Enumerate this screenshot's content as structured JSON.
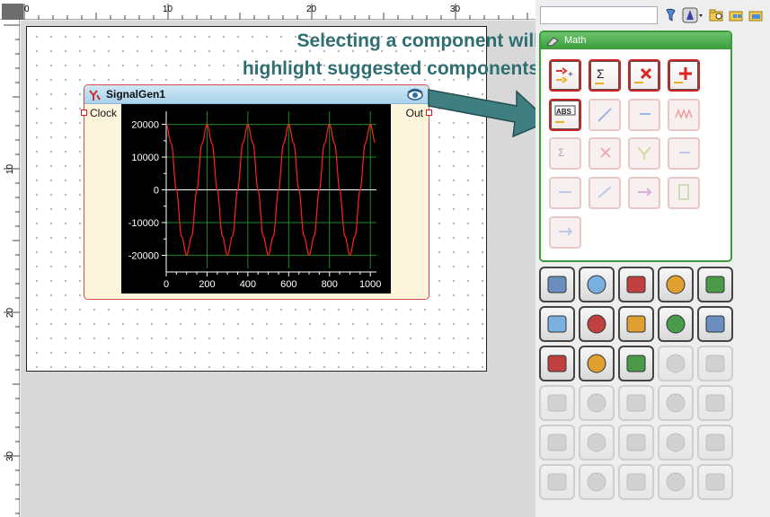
{
  "ruler": {
    "top_ticks": [
      "0",
      "10",
      "20",
      "30"
    ],
    "left_ticks": [
      "10",
      "20",
      "30"
    ]
  },
  "component": {
    "title": "SignalGen1",
    "input_port": "Clock",
    "output_port": "Out"
  },
  "chart_data": {
    "type": "line",
    "x": [
      0,
      25,
      50,
      75,
      100,
      125,
      150,
      175,
      200,
      225,
      250,
      275,
      300,
      325,
      350,
      375,
      400,
      425,
      450,
      475,
      500,
      525,
      550,
      575,
      600,
      625,
      650,
      675,
      700,
      725,
      750,
      775,
      800,
      825,
      850,
      875,
      900,
      925,
      950,
      975,
      1000,
      1025
    ],
    "series": [
      {
        "values": [
          20000,
          14142,
          0,
          -14142,
          -20000,
          -14142,
          0,
          14142,
          20000,
          14142,
          0,
          -14142,
          -20000,
          -14142,
          0,
          14142,
          20000,
          14142,
          0,
          -14142,
          -20000,
          -14142,
          0,
          14142,
          20000,
          14142,
          0,
          -14142,
          -20000,
          -14142,
          0,
          14142,
          20000,
          14142,
          0,
          -14142,
          -20000,
          -14142,
          0,
          14142,
          20000,
          14142
        ],
        "color": "#ff2020"
      }
    ],
    "xticks": [
      "0",
      "200",
      "400",
      "600",
      "800",
      "1000"
    ],
    "yticks": [
      "20000",
      "10000",
      "0",
      "-10000",
      "-20000"
    ],
    "xlim": [
      0,
      1030
    ],
    "ylim": [
      -24000,
      24000
    ],
    "grid": true,
    "background": "#000000",
    "grid_color": "#1d8a1d"
  },
  "palette": {
    "search_placeholder": "",
    "group_title": "Math",
    "accent": "#3c9b3c"
  },
  "annotation": {
    "line1": "Selecting a component will",
    "line2": "highlight suggested components"
  }
}
